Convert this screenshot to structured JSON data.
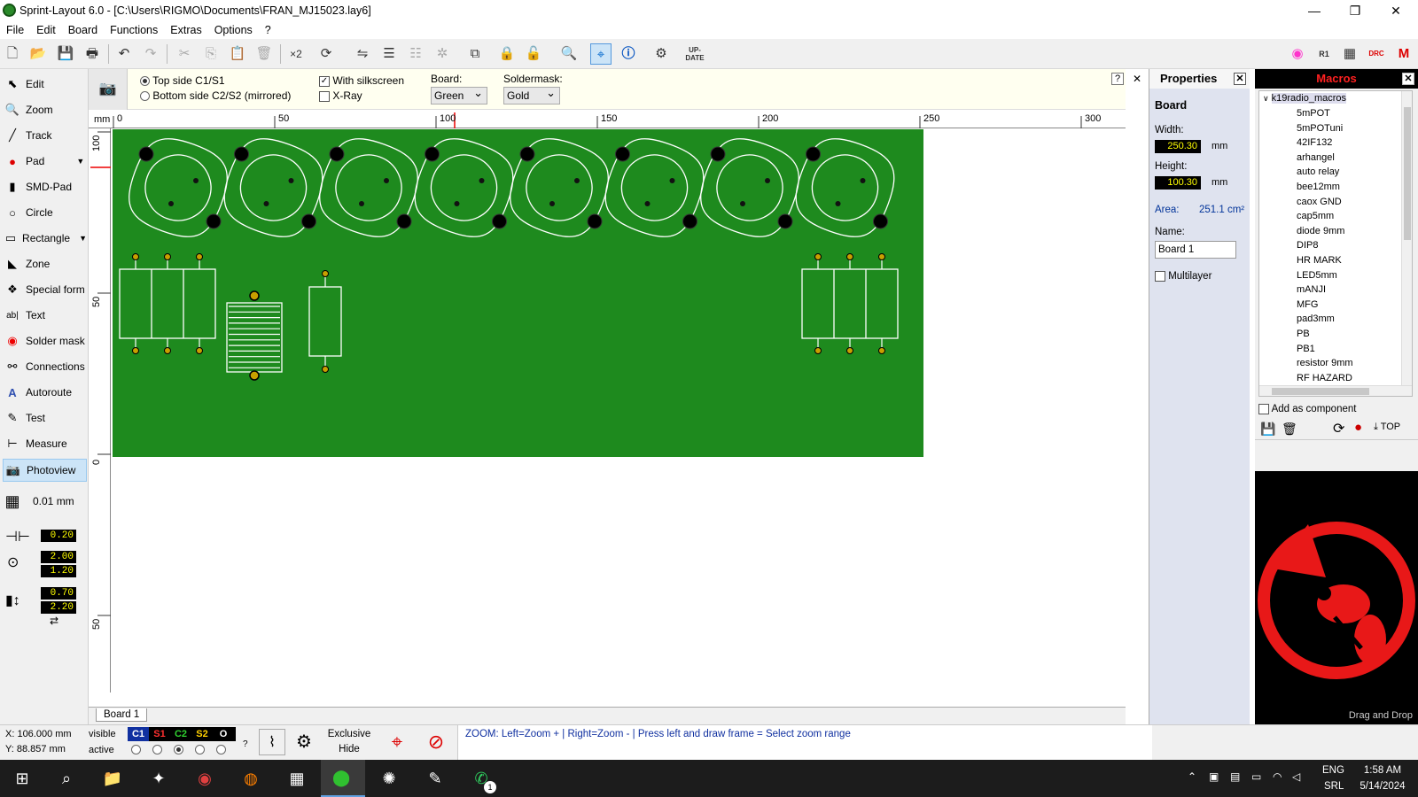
{
  "window": {
    "title": "Sprint-Layout 6.0 - [C:\\Users\\RIGMO\\Documents\\FRAN_MJ15023.lay6]",
    "minimize": "—",
    "restore": "❐",
    "close": "✕"
  },
  "menu": [
    "File",
    "Edit",
    "Board",
    "Functions",
    "Extras",
    "Options",
    "?"
  ],
  "tools": [
    {
      "label": "Edit",
      "icon": "pointer-icon"
    },
    {
      "label": "Zoom",
      "icon": "magnifier-icon"
    },
    {
      "label": "Track",
      "icon": "track-icon"
    },
    {
      "label": "Pad",
      "icon": "pad-icon"
    },
    {
      "label": "SMD-Pad",
      "icon": "smd-pad-icon"
    },
    {
      "label": "Circle",
      "icon": "circle-icon"
    },
    {
      "label": "Rectangle",
      "icon": "rectangle-icon"
    },
    {
      "label": "Zone",
      "icon": "zone-icon"
    },
    {
      "label": "Special form",
      "icon": "special-form-icon"
    },
    {
      "label": "Text",
      "icon": "text-icon"
    },
    {
      "label": "Solder mask",
      "icon": "solder-mask-icon"
    },
    {
      "label": "Connections",
      "icon": "connections-icon"
    },
    {
      "label": "Autoroute",
      "icon": "autoroute-icon"
    },
    {
      "label": "Test",
      "icon": "test-icon"
    },
    {
      "label": "Measure",
      "icon": "measure-icon"
    },
    {
      "label": "Photoview",
      "icon": "camera-icon"
    }
  ],
  "grid": "0.01 mm",
  "track_width": "0.20",
  "pad_outer": "2.00",
  "pad_inner": "1.20",
  "smd_w": "0.70",
  "smd_h": "2.20",
  "photo": {
    "top_side": "Top side C1/S1",
    "bottom_side": "Bottom side C2/S2 (mirrored)",
    "silkscreen": "With silkscreen",
    "xray": "X-Ray",
    "board_label": "Board:",
    "board_value": "Green",
    "soldermask_label": "Soldermask:",
    "soldermask_value": "Gold",
    "help": "?",
    "close": "✕"
  },
  "ruler": {
    "unit": "mm",
    "top_ticks": [
      "0",
      "50",
      "100",
      "150",
      "200",
      "250",
      "300"
    ],
    "left_ticks": [
      "100",
      "50",
      "0",
      "50"
    ]
  },
  "colors": {
    "board": "#1e8a1e",
    "silk": "#ffffff",
    "pad_copper": "#c8a000"
  },
  "tab": "Board 1",
  "properties": {
    "title": "Properties",
    "section": "Board",
    "width_label": "Width:",
    "width_value": "250.30",
    "height_label": "Height:",
    "height_value": "100.30",
    "unit": "mm",
    "area_label": "Area:",
    "area_value": "251.1 cm²",
    "name_label": "Name:",
    "name_value": "Board 1",
    "multilayer": "Multilayer"
  },
  "macros": {
    "title": "Macros",
    "root": "k19radio_macros",
    "items": [
      "5mPOT",
      "5mPOTuni",
      "42IF132",
      "arhangel",
      "auto relay",
      "bee12mm",
      "caox GND",
      "cap5mm",
      "diode 9mm",
      "DIP8",
      "HR MARK",
      "LED5mm",
      "mANJI",
      "MFG",
      "pad3mm",
      "PB",
      "PB1",
      "resistor 9mm",
      "RF HAZARD"
    ],
    "add_component": "Add as component",
    "top": "TOP",
    "drag": "Drag and Drop"
  },
  "status": {
    "x": "X:  106.000 mm",
    "y": "Y:   88.857 mm",
    "visible": "visible",
    "active": "active",
    "layers": [
      "C1",
      "S1",
      "C2",
      "S2",
      "O"
    ],
    "exclusive": "Exclusive",
    "hide": "Hide",
    "hint": "ZOOM:  Left=Zoom +  |  Right=Zoom -  |  Press left and draw frame = Select zoom range",
    "q": "?"
  },
  "taskbar": {
    "lang1": "ENG",
    "lang2": "SRL",
    "time": "1:58 AM",
    "date": "5/14/2024",
    "badge": "1"
  }
}
